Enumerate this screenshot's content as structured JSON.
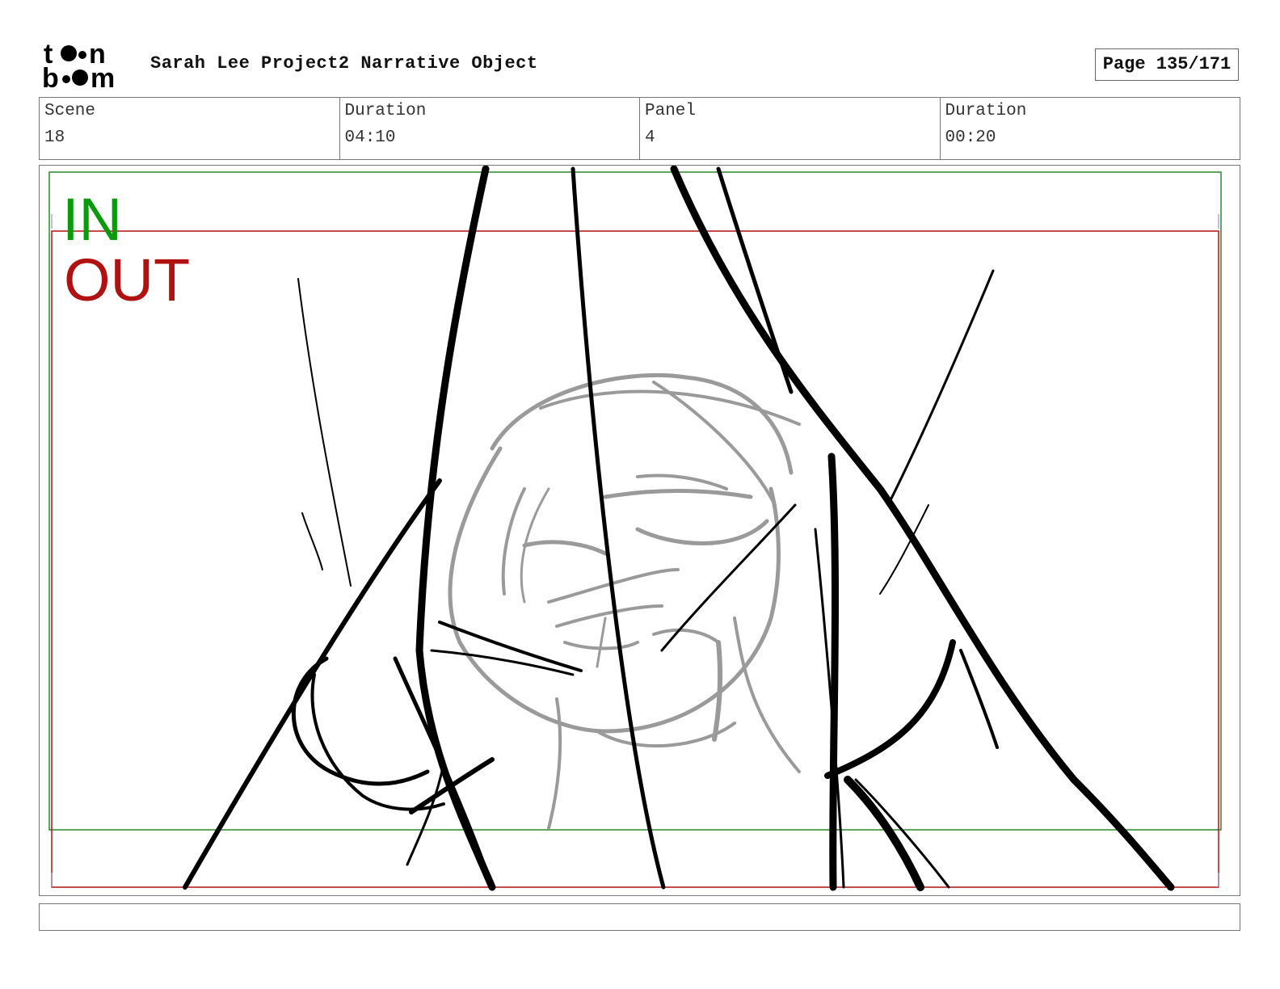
{
  "header": {
    "logo_text": "toon boom",
    "title": "Sarah Lee Project2 Narrative Object",
    "page": "Page 135/171"
  },
  "info": {
    "scene_label": "Scene",
    "scene_value": "18",
    "duration_label": "Duration",
    "duration_value": "04:10",
    "panel_label": "Panel",
    "panel_value": "4",
    "panel_duration_label": "Duration",
    "panel_duration_value": "00:20"
  },
  "panel": {
    "in_label": "IN",
    "out_label": "OUT",
    "in_color": "#0a9a0a",
    "out_color": "#b01212"
  },
  "notes": {
    "text": ""
  }
}
